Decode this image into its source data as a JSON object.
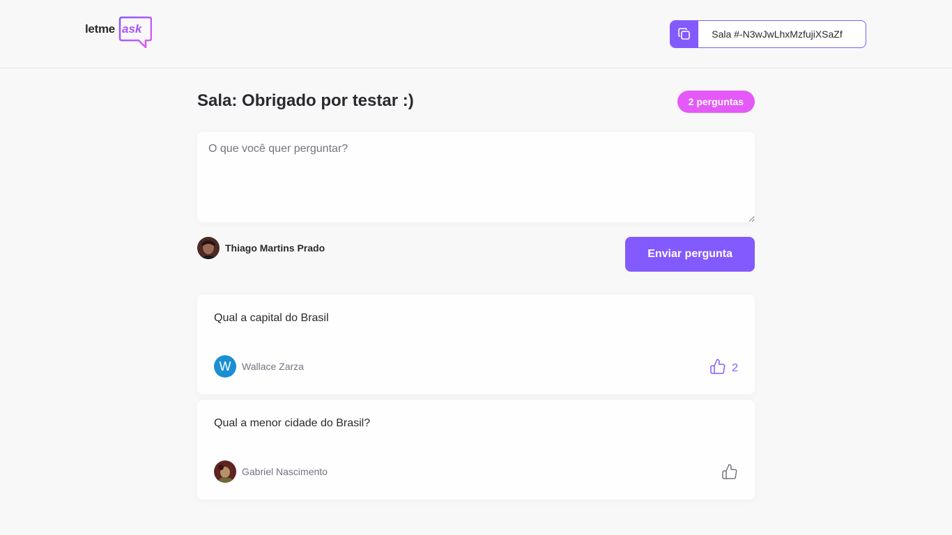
{
  "header": {
    "logo_text": "letme",
    "logo_accent": "ask",
    "room_code_label": "Sala #-N3wJwLhxMzfujiXSaZf"
  },
  "room": {
    "title": "Sala: Obrigado por testar :)",
    "question_count": "2 perguntas"
  },
  "form": {
    "placeholder": "O que você quer perguntar?",
    "user_name": "Thiago Martins Prado",
    "submit_label": "Enviar pergunta"
  },
  "questions": [
    {
      "content": "Qual a capital do Brasil",
      "author": "Wallace Zarza",
      "author_initial": "W",
      "likes": "2"
    },
    {
      "content": "Qual a menor cidade do Brasil?",
      "author": "Gabriel Nascimento",
      "likes": ""
    }
  ],
  "colors": {
    "accent": "#835afd",
    "badge": "#e559f9",
    "background": "#f8f8f8",
    "text": "#29292e",
    "muted": "#737380"
  },
  "icons": {
    "copy": "copy-icon",
    "like": "thumbs-up-icon"
  }
}
